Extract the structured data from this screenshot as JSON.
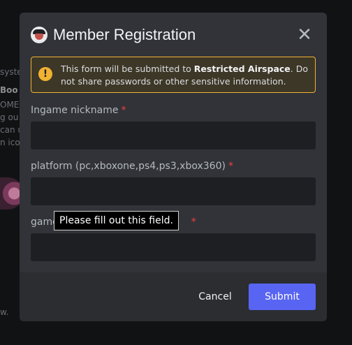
{
  "background": {
    "fragments": [
      "syste",
      "Boo",
      "OME",
      "g ou",
      "can u",
      "n icon",
      "w."
    ]
  },
  "modal": {
    "title": "Member Registration",
    "close_icon": "close-icon",
    "app_icon": "app-avatar-icon",
    "warning": {
      "icon": "!",
      "text_before": "This form will be submitted to ",
      "server_name": "Restricted Airspace",
      "text_after": ". Do not share passwords or other sensitive information."
    },
    "fields": [
      {
        "label": "Ingame nickname",
        "required": "*",
        "value": ""
      },
      {
        "label": "platform (pc,xboxone,ps4,ps3,xbox360)",
        "required": "*",
        "value": ""
      },
      {
        "label": "game",
        "required": "*",
        "value": ""
      }
    ],
    "validation_tooltip": "Please fill out this field.",
    "footer": {
      "cancel_label": "Cancel",
      "submit_label": "Submit"
    }
  },
  "colors": {
    "accent": "#5865f2",
    "warning": "#f0b232",
    "required": "#f23f43"
  }
}
